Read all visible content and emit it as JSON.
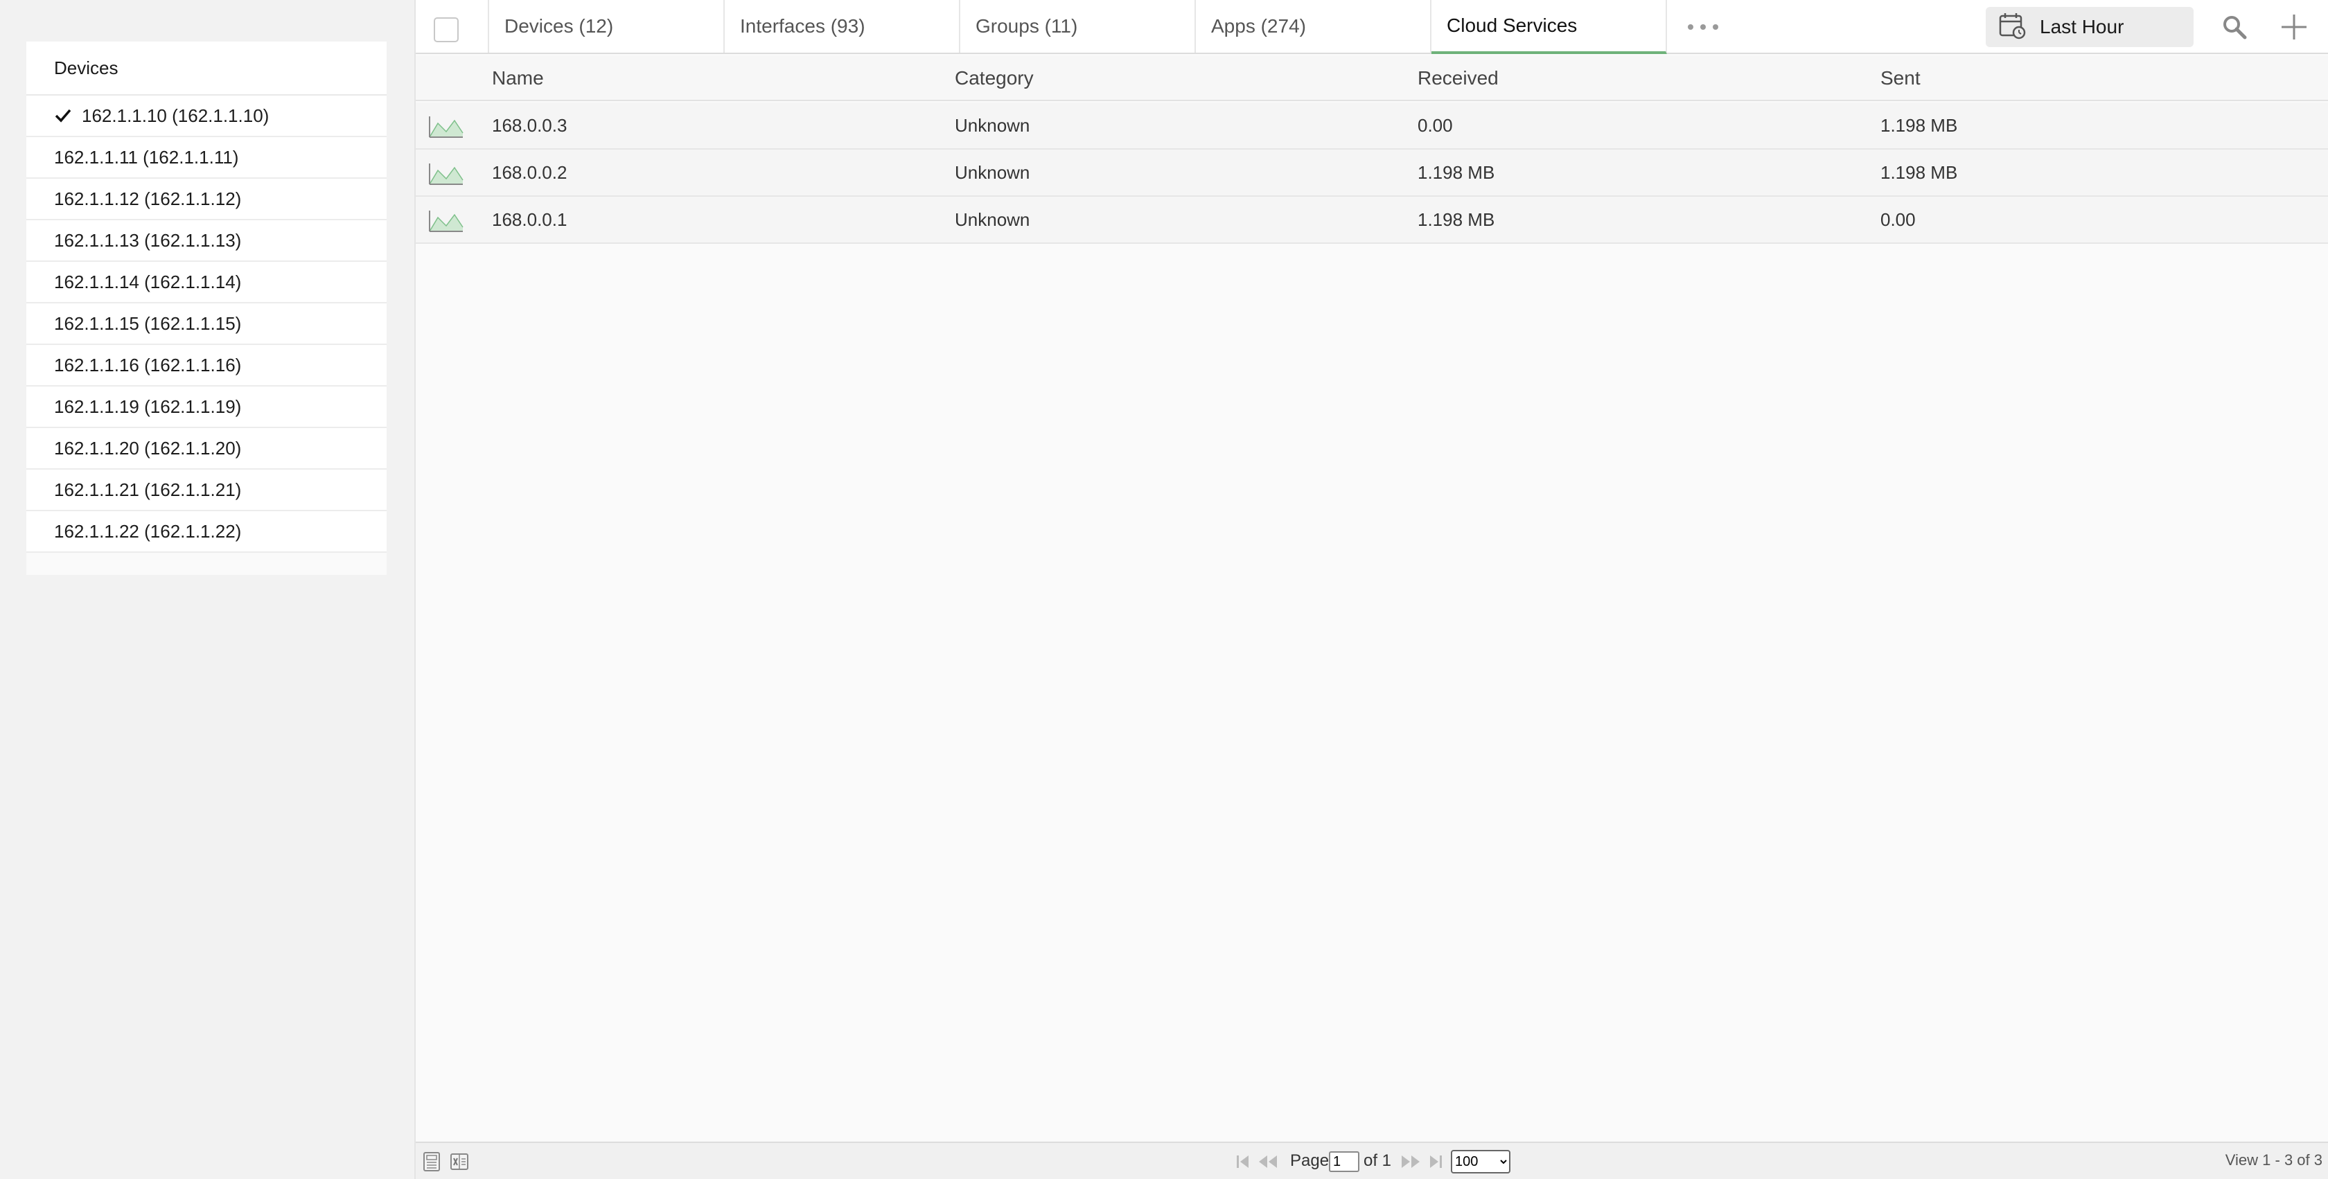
{
  "sidebar": {
    "title": "Devices",
    "items": [
      {
        "label": "162.1.1.10 (162.1.1.10)",
        "selected": true
      },
      {
        "label": "162.1.1.11 (162.1.1.11)",
        "selected": false
      },
      {
        "label": "162.1.1.12 (162.1.1.12)",
        "selected": false
      },
      {
        "label": "162.1.1.13 (162.1.1.13)",
        "selected": false
      },
      {
        "label": "162.1.1.14 (162.1.1.14)",
        "selected": false
      },
      {
        "label": "162.1.1.15 (162.1.1.15)",
        "selected": false
      },
      {
        "label": "162.1.1.16 (162.1.1.16)",
        "selected": false
      },
      {
        "label": "162.1.1.19 (162.1.1.19)",
        "selected": false
      },
      {
        "label": "162.1.1.20 (162.1.1.20)",
        "selected": false
      },
      {
        "label": "162.1.1.21 (162.1.1.21)",
        "selected": false
      },
      {
        "label": "162.1.1.22 (162.1.1.22)",
        "selected": false
      }
    ]
  },
  "tabs": [
    {
      "label": "Devices (12)",
      "active": false
    },
    {
      "label": "Interfaces (93)",
      "active": false
    },
    {
      "label": "Groups (11)",
      "active": false
    },
    {
      "label": "Apps (274)",
      "active": false
    },
    {
      "label": "Cloud Services",
      "active": true
    }
  ],
  "toolbar": {
    "time_range": "Last Hour",
    "icons": [
      "calendar-icon",
      "more-icon",
      "search-icon",
      "add-icon"
    ]
  },
  "table": {
    "columns": [
      "Name",
      "Category",
      "Received",
      "Sent"
    ],
    "rows": [
      {
        "name": "168.0.0.3",
        "category": "Unknown",
        "received": "0.00",
        "sent": "1.198 MB"
      },
      {
        "name": "168.0.0.2",
        "category": "Unknown",
        "received": "1.198 MB",
        "sent": "1.198 MB"
      },
      {
        "name": "168.0.0.1",
        "category": "Unknown",
        "received": "1.198 MB",
        "sent": "0.00"
      }
    ]
  },
  "footer": {
    "page_label": "Page",
    "page_value": "1",
    "of_label": "of 1",
    "page_size": "100",
    "view_count": "View 1 - 3 of 3",
    "icons": [
      "calculator-icon",
      "excel-export-icon",
      "first-page-icon",
      "prev-page-icon",
      "next-page-icon",
      "last-page-icon"
    ]
  },
  "colors": {
    "accent": "#6fb27a",
    "graph_fill": "#cfe8d2",
    "graph_stroke": "#7ec08a"
  }
}
